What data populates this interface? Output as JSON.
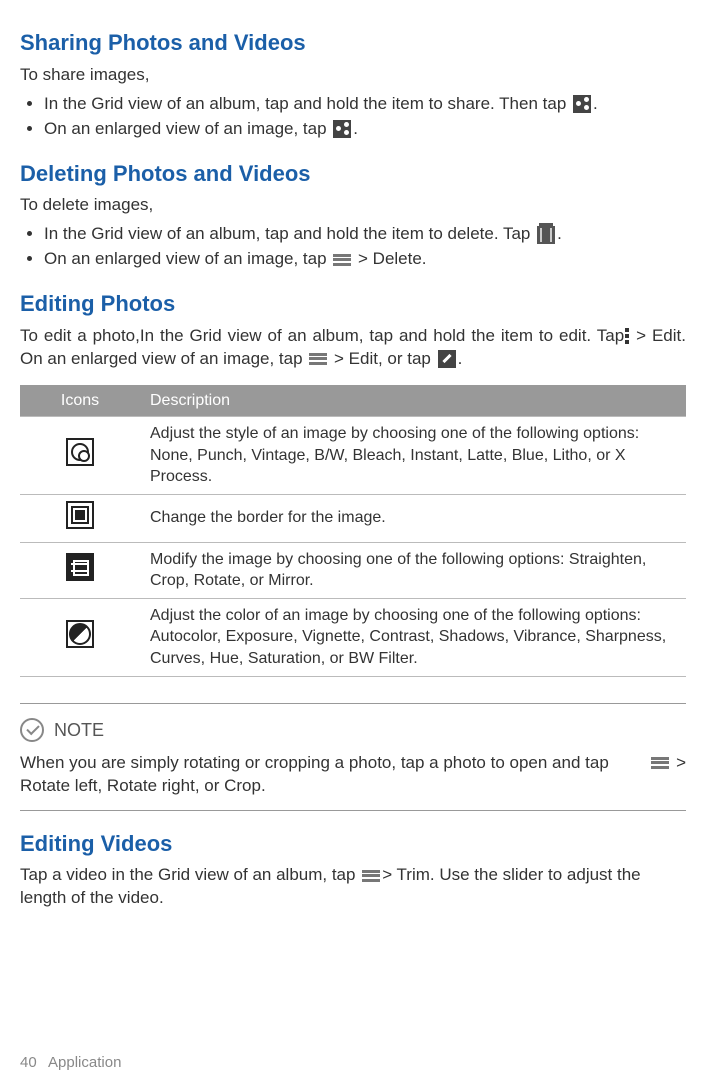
{
  "sections": {
    "sharing": {
      "heading": "Sharing Photos and Videos",
      "intro": "To share images,",
      "bullet1_a": "In the Grid view of an album, tap and hold the item to share. Then tap  ",
      "bullet1_b": ".",
      "bullet2_a": "On an enlarged view of an image, tap ",
      "bullet2_b": "."
    },
    "deleting": {
      "heading": "Deleting Photos and Videos",
      "intro": "To delete images,",
      "bullet1_a": "In the Grid view of an album, tap and hold the item to delete. Tap  ",
      "bullet1_b": ".",
      "bullet2_a": "On an enlarged view of an image, tap ",
      "bullet2_b": " > Delete."
    },
    "editing_photos": {
      "heading": "Editing Photos",
      "para_a": "To edit a photo,In the Grid view of an album, tap and hold the item to edit. Tap",
      "para_b": " > Edit. On an enlarged view of an image, tap ",
      "para_c": " > Edit, or tap ",
      "para_d": "."
    },
    "editing_videos": {
      "heading": "Editing Videos",
      "para_a": "Tap a video in the Grid view of an album, tap",
      "para_b": "> Trim. Use the slider to adjust the length of the video."
    }
  },
  "table": {
    "headers": {
      "icons": "Icons",
      "description": "Description"
    },
    "rows": [
      {
        "desc": "Adjust the style of an image by choosing one of the following options: None, Punch, Vintage, B/W, Bleach, Instant, Latte, Blue, Litho, or X Process."
      },
      {
        "desc": "Change the border for the image."
      },
      {
        "desc": "Modify the image by choosing one of the following options: Straighten, Crop, Rotate, or Mirror."
      },
      {
        "desc": "Adjust the color of an image by choosing one of the following   options: Autocolor, Exposure, Vignette, Contrast, Shadows, Vibrance, Sharpness, Curves, Hue, Saturation, or BW Filter."
      }
    ]
  },
  "note": {
    "label": "NOTE",
    "body_a": "When you are simply rotating or cropping a photo, tap a photo to open and tap",
    "body_gt": " >",
    "body_b": "Rotate left, Rotate right, or Crop."
  },
  "footer": {
    "page": "40",
    "section": "Application"
  }
}
